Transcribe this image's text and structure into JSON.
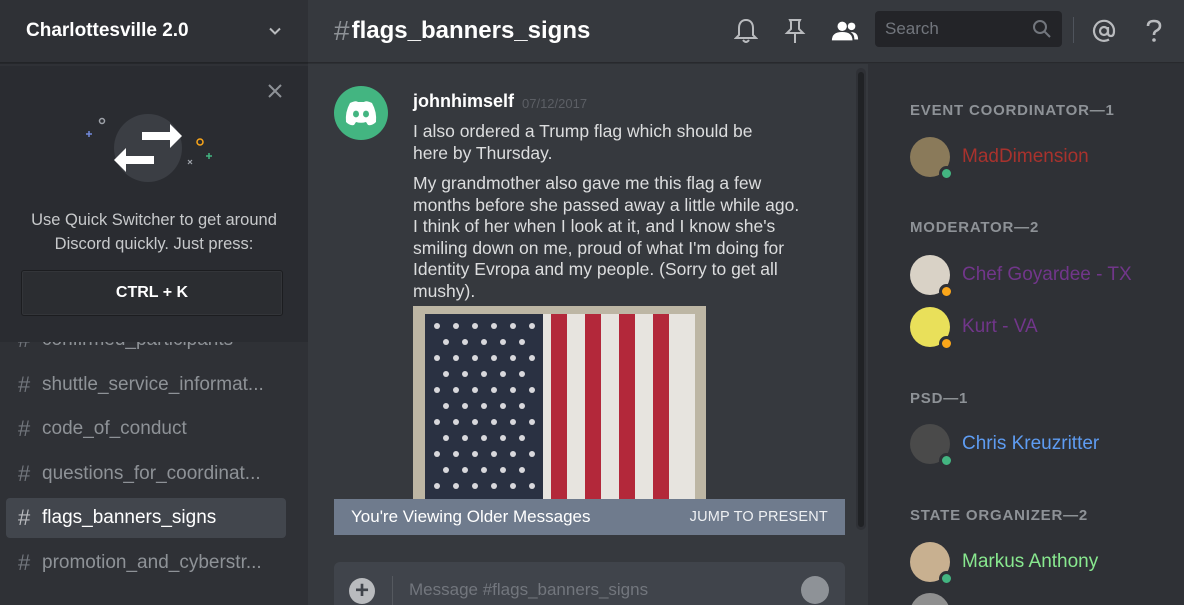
{
  "server": {
    "name": "Charlottesville 2.0"
  },
  "quick_switcher": {
    "line1": "Use Quick Switcher to get around",
    "line2": "Discord quickly. Just press:",
    "shortcut": "CTRL + K"
  },
  "channels": [
    {
      "name": "confirmed_participants",
      "active": false
    },
    {
      "name": "shuttle_service_informat...",
      "active": false
    },
    {
      "name": "code_of_conduct",
      "active": false
    },
    {
      "name": "questions_for_coordinat...",
      "active": false
    },
    {
      "name": "flags_banners_signs",
      "active": true
    },
    {
      "name": "promotion_and_cyberstr...",
      "active": false
    }
  ],
  "header": {
    "hash": "#",
    "channel": "flags_banners_signs",
    "search_placeholder": "Search",
    "icons": [
      "bell-icon",
      "pin-icon",
      "members-icon",
      "search-icon",
      "at-icon",
      "help-icon"
    ]
  },
  "message": {
    "author": "johnhimself",
    "timestamp": "07/12/2017",
    "lines1": [
      "I also ordered a Trump flag which should be",
      "here by Thursday."
    ],
    "lines2": [
      "My grandmother also gave me this flag a few",
      "months before she passed away a little while ago.",
      "I think of her when I look at it, and I know she's",
      "smiling down on me, proud of what I'm doing for",
      "Identity Evropa and my people. (Sorry to get all",
      "mushy)."
    ]
  },
  "older_bar": {
    "text": "You're Viewing Older Messages",
    "jump": "JUMP TO PRESENT"
  },
  "composer": {
    "placeholder": "Message #flags_banners_signs"
  },
  "member_groups": [
    {
      "title": "EVENT COORDINATOR—1",
      "members": [
        {
          "name": "MadDimension",
          "color": "#a8322d",
          "status": "#43b581"
        }
      ]
    },
    {
      "title": "MODERATOR—2",
      "members": [
        {
          "name": "Chef Goyardee - TX",
          "color": "#71368a",
          "status": "#faa61a"
        },
        {
          "name": "Kurt - VA",
          "color": "#71368a",
          "status": "#faa61a"
        }
      ]
    },
    {
      "title": "PSD—1",
      "members": [
        {
          "name": "Chris Kreuzritter",
          "color": "#5e9cf2",
          "status": "#43b581"
        }
      ]
    },
    {
      "title": "STATE ORGANIZER—2",
      "members": [
        {
          "name": "Markus Anthony",
          "color": "#88e88f",
          "status": "#43b581"
        }
      ]
    }
  ],
  "colors": {
    "accent_online": "#43b581",
    "accent_idle": "#faa61a",
    "bg": "#36393e",
    "sidebar": "#2f3136"
  }
}
